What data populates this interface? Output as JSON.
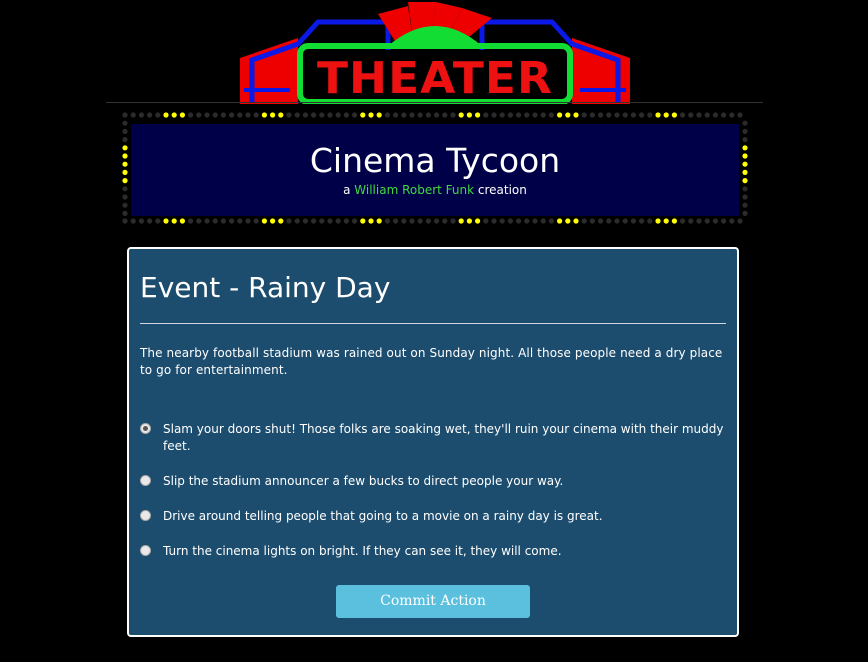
{
  "logo": {
    "text": "THEATER"
  },
  "marquee": {
    "title": "Cinema Tycoon",
    "byline_prefix": "a ",
    "author": "William Robert Funk",
    "byline_suffix": " creation"
  },
  "event": {
    "title": "Event - Rainy Day",
    "description": "The nearby football stadium was rained out on Sunday night. All those people need a dry place to go for entertainment.",
    "options": [
      {
        "label": "Slam your doors shut! Those folks are soaking wet, they'll ruin your cinema with their muddy feet.",
        "selected": true
      },
      {
        "label": "Slip the stadium announcer a few bucks to direct people your way.",
        "selected": false
      },
      {
        "label": "Drive around telling people that going to a movie on a rainy day is great.",
        "selected": false
      },
      {
        "label": "Turn the cinema lights on bright. If they can see it, they will come.",
        "selected": false
      }
    ],
    "commit_label": "Commit Action"
  },
  "colors": {
    "page_bg": "#000000",
    "marquee_panel": "#000048",
    "author": "#3fd93f",
    "card_bg": "#1c4d6e",
    "button": "#5bc0de",
    "bulb_on": "#ffff00",
    "bulb_off": "#2b2b2b"
  }
}
